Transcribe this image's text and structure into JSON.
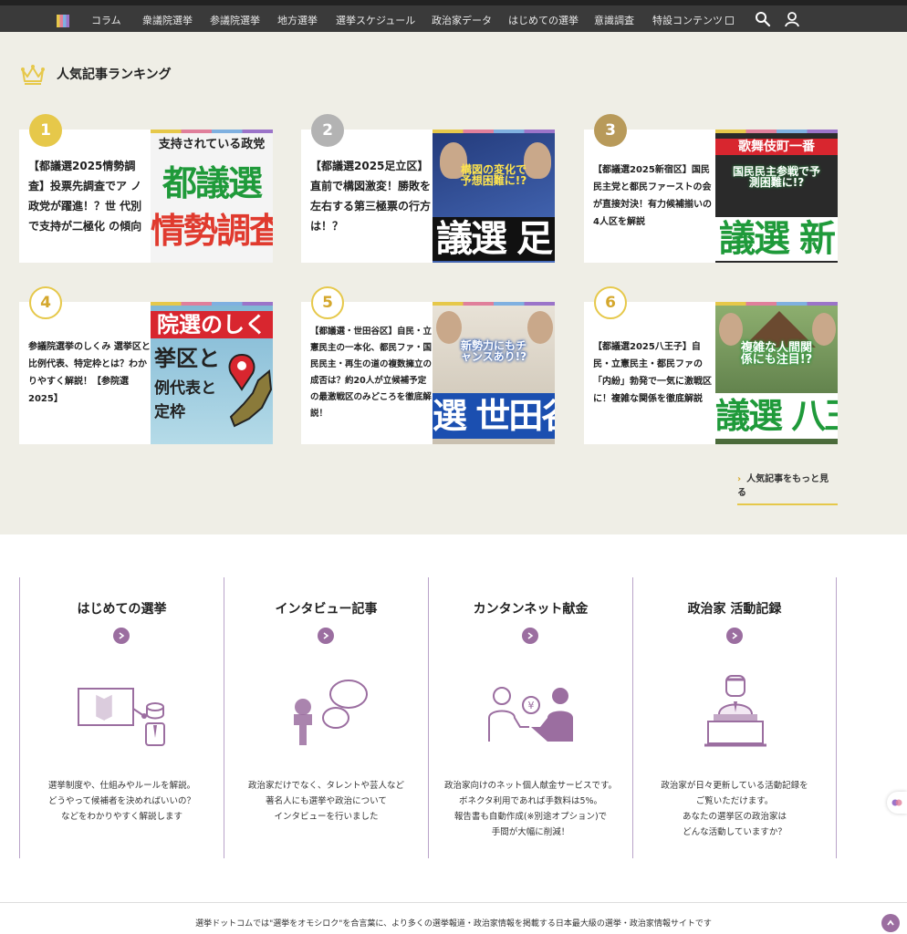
{
  "nav": {
    "items": [
      "コラム",
      "衆議院選挙",
      "参議院選挙",
      "地方選挙",
      "選挙スケジュール",
      "政治家データ",
      "はじめての選挙",
      "意識調査",
      "特設コンテンツ"
    ],
    "search_icon": "search-icon",
    "user_icon": "user-icon"
  },
  "ranking": {
    "title": "人気記事ランキング",
    "more_label": "人気記事をもっと見る",
    "items": [
      {
        "rank": "1",
        "title": "【都議選2025情勢調査】投票先調査でア ノ政党が躍進！？世 代別で支持が二極化 の傾向",
        "thumb_top": "支持されている政党",
        "thumb_l1": "都議選",
        "thumb_l2": "情勢調査"
      },
      {
        "rank": "2",
        "title": "【都議選2025足立区】直前で構図激変！勝敗を左右する第三極票の行方は！？",
        "thumb_top": "構図の変化で予想困難に!?",
        "thumb_l1": "",
        "thumb_l2": "議選 足"
      },
      {
        "rank": "3",
        "title": "【都議選2025新宿区】国民民主党と都民ファーストの会が直接対決！有力候補揃いの4人区を解説",
        "thumb_top": "歌舞伎町一番",
        "thumb_l1": "国民民主参戦で予測困難に!?",
        "thumb_l2": "議選 新"
      },
      {
        "rank": "4",
        "title": "参議院選挙のしくみ 選挙区と比例代表、特定枠とは？わかりやすく解説！【参院選2025】",
        "thumb_top": "院選のしく",
        "thumb_l1": "挙区と",
        "thumb_l2": "例代表と 定枠"
      },
      {
        "rank": "5",
        "title": "【都議選・世田谷区】自民・立憲民主の一本化、都民ファ・国民民主・再生の道の複数擁立の成否は？約20人が立候補予定の最激戦区のみどころを徹底解説！",
        "thumb_top": "新勢力にもチャンスあり!?",
        "thumb_l1": "",
        "thumb_l2": "選 世田谷"
      },
      {
        "rank": "6",
        "title": "【都議選2025八王子】自民・立憲民主・都民ファの「内紛」勃発で一気に激戦区に！複雑な関係を徹底解説",
        "thumb_top": "複雑な人間関係にも注目!?",
        "thumb_l1": "",
        "thumb_l2": "議選 八王"
      }
    ]
  },
  "features": [
    {
      "title": "はじめての選挙",
      "desc": "選挙制度や、仕組みやルールを解説。\nどうやって候補者を決めればいいの？\nなどをわかりやすく解説します",
      "icon": "board-teacher-icon"
    },
    {
      "title": "インタビュー記事",
      "desc": "政治家だけでなく、タレントや芸人など\n著名人にも選挙や政治について\nインタビューを行いました",
      "icon": "microphone-speech-icon"
    },
    {
      "title": "カンタンネット献金",
      "desc": "政治家向けのネット個人献金サービスです。\nボネクタ利用であれば手数料は5%。\n報告書も自動作成(※別途オプション)で\n手間が大幅に削減！",
      "icon": "donation-handshake-icon"
    },
    {
      "title": "政治家 活動記録",
      "desc": "政治家が日々更新している活動記録を\nご覧いただけます。\nあなたの選挙区の政治家は\nどんな活動していますか？",
      "icon": "politician-podium-icon"
    }
  ],
  "footer": {
    "text": "選挙ドットコムでは\"選挙をオモシロク\"を合言葉に、より多くの選挙報道・政治家情報を掲載する日本最大級の選挙・政治家情報サイトです"
  },
  "colors": {
    "accent_purple": "#9b6ea0",
    "gold": "#e6c84a",
    "silver": "#b3b3b3",
    "bronze": "#b89a5a",
    "ranking_bg": "#efeee6"
  }
}
